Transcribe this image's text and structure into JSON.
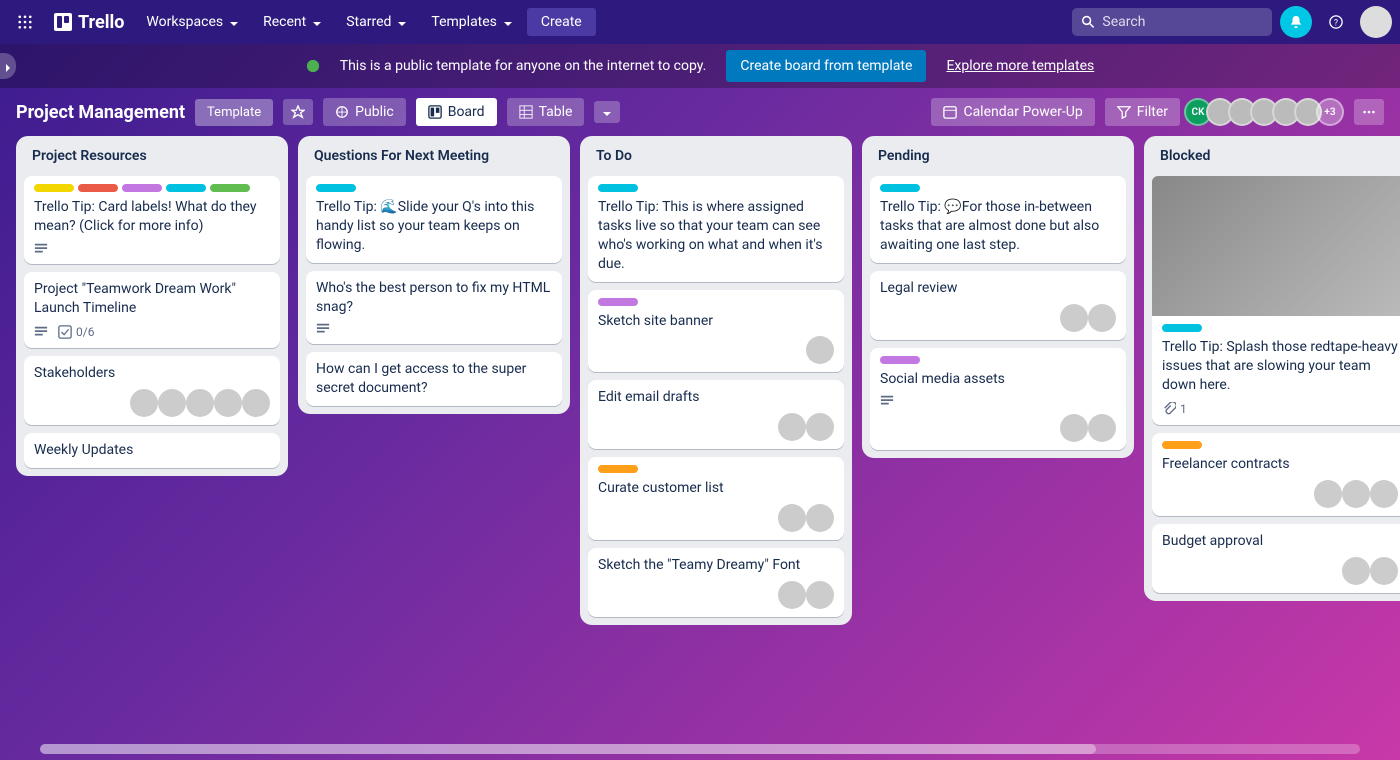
{
  "topbar": {
    "logo": "Trello",
    "nav": [
      "Workspaces",
      "Recent",
      "Starred",
      "Templates"
    ],
    "create": "Create",
    "search_placeholder": "Search"
  },
  "banner": {
    "text": "This is a public template for anyone on the internet to copy.",
    "create_btn": "Create board from template",
    "explore_link": "Explore more templates"
  },
  "board_header": {
    "title": "Project Management",
    "template_badge": "Template",
    "visibility": "Public",
    "view_board": "Board",
    "view_table": "Table",
    "calendar": "Calendar Power-Up",
    "filter": "Filter",
    "avatars_extra": "+3",
    "avatar_initials": "CK"
  },
  "lists": [
    {
      "title": "Project Resources",
      "cards": [
        {
          "labels": [
            "yellow",
            "red",
            "purple",
            "sky",
            "green"
          ],
          "text": "Trello Tip: Card labels! What do they mean? (Click for more info)",
          "desc": true
        },
        {
          "text": "Project \"Teamwork Dream Work\" Launch Timeline",
          "desc": true,
          "checklist": "0/6"
        },
        {
          "text": "Stakeholders",
          "members": 5
        },
        {
          "text": "Weekly Updates"
        }
      ]
    },
    {
      "title": "Questions For Next Meeting",
      "cards": [
        {
          "labels": [
            "sky"
          ],
          "text": "Trello Tip: 🌊Slide your Q's into this handy list so your team keeps on flowing."
        },
        {
          "text": "Who's the best person to fix my HTML snag?",
          "desc": true
        },
        {
          "text": "How can I get access to the super secret document?"
        }
      ]
    },
    {
      "title": "To Do",
      "cards": [
        {
          "labels": [
            "sky"
          ],
          "text": "Trello Tip: This is where assigned tasks live so that your team can see who's working on what and when it's due."
        },
        {
          "labels": [
            "purple"
          ],
          "text": "Sketch site banner",
          "members": 1
        },
        {
          "text": "Edit email drafts",
          "members": 2
        },
        {
          "labels": [
            "orange"
          ],
          "text": "Curate customer list",
          "members": 2
        },
        {
          "text": "Sketch the \"Teamy Dreamy\" Font",
          "members": 2
        }
      ]
    },
    {
      "title": "Pending",
      "cards": [
        {
          "labels": [
            "sky"
          ],
          "text": "Trello Tip: 💬For those in-between tasks that are almost done but also awaiting one last step."
        },
        {
          "text": "Legal review",
          "members": 2
        },
        {
          "labels": [
            "purple"
          ],
          "text": "Social media assets",
          "desc": true,
          "members": 2
        }
      ]
    },
    {
      "title": "Blocked",
      "cards": [
        {
          "cover": true,
          "labels": [
            "sky"
          ],
          "text": "Trello Tip: Splash those redtape-heavy issues that are slowing your team down here.",
          "attachment": "1"
        },
        {
          "labels": [
            "orange"
          ],
          "text": "Freelancer contracts",
          "members": 3
        },
        {
          "text": "Budget approval",
          "members": 2
        }
      ]
    }
  ],
  "label_colors": {
    "yellow": "#f2d600",
    "red": "#eb5a46",
    "purple": "#c377e0",
    "sky": "#00c2e0",
    "green": "#61bd4f",
    "orange": "#ff9f1a"
  }
}
